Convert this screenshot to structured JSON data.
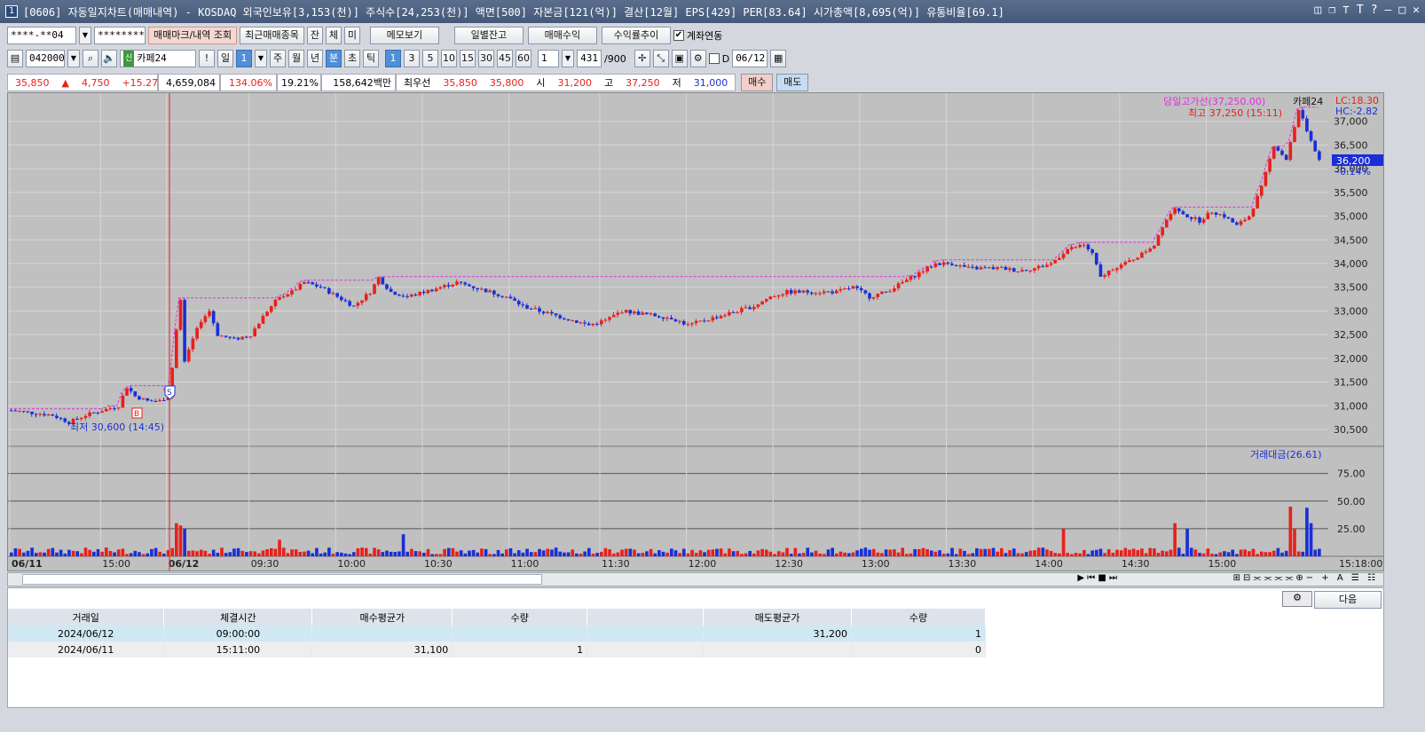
{
  "title": {
    "window_number": "1",
    "text": "[0606] 자동일지차트(매매내역) - KOSDAQ 외국인보유[3,153(천)] 주식수[24,253(천)] 액면[500] 자본금[121(억)] 결산[12월] EPS[429] PER[83.64] 시가총액[8,695(억)] 유통비율[69.1]"
  },
  "toolbar1": {
    "account": "****-**04",
    "password": "********",
    "mark_btn": "매매마크/내역 조회",
    "recent_btn": "최근매매종목",
    "jan": "잔",
    "che": "체",
    "mi": "미",
    "memo": "메모보기",
    "daily_balance": "일별잔고",
    "trade_profit": "매매수익",
    "profit_trend": "수익률추이",
    "account_link": "계좌연동"
  },
  "toolbar2": {
    "code": "042000",
    "badge": "신",
    "stock_name": "카페24",
    "excl": "!",
    "il": "일",
    "il_val": "1",
    "ju": "주",
    "wol": "월",
    "nyeon": "년",
    "bun": "분",
    "cho": "초",
    "tick": "틱",
    "intervals": [
      "1",
      "3",
      "5",
      "10",
      "15",
      "30",
      "45",
      "60"
    ],
    "period": "1",
    "count": "431",
    "count_total": "/900",
    "d_label": "D",
    "date": "06/12"
  },
  "infobar": {
    "price": "35,850",
    "arrow": "▲",
    "change": "4,750",
    "change_pct": "+15.27%",
    "volume": "4,659,084",
    "vol_ratio": "134.06%",
    "turnover": "19.21%",
    "amount": "158,642백만",
    "best_label": "최우선",
    "best_ask": "35,850",
    "best_bid": "35,800",
    "open_label": "시",
    "open": "31,200",
    "high_label": "고",
    "high": "37,250",
    "low_label": "저",
    "low": "31,000",
    "buy": "매수",
    "sell": "매도"
  },
  "chart_labels": {
    "day_high_line": "당일고가선(37,250.00)",
    "stock_tag": "카페24",
    "lc": "LC:18.30",
    "hc": "HC:-2.82",
    "max_label": "최고 37,250 (15:11)",
    "min_label": "최저 30,600 (14:45)",
    "current_price": "36,200",
    "current_pct": "-0.14%",
    "mark_b": "B",
    "mark_s": "S",
    "volume_label": "거래대금(26.61)",
    "last_time": "15:18:00"
  },
  "colors": {
    "up": "#e8201b",
    "down": "#1a2fd6",
    "high_line": "#e030e0",
    "background": "#c0c0c0"
  },
  "chart_data": {
    "type": "candlestick",
    "price_axis": [
      "37,000",
      "36,500",
      "36,000",
      "35,500",
      "35,000",
      "34,500",
      "34,000",
      "33,500",
      "33,000",
      "32,500",
      "32,000",
      "31,500",
      "31,000",
      "30,500"
    ],
    "volume_axis": [
      "75.00",
      "50.00",
      "25.00"
    ],
    "time_labels": [
      "06/11",
      "15:00",
      "06/12",
      "09:30",
      "10:00",
      "10:30",
      "11:00",
      "11:30",
      "12:00",
      "12:30",
      "13:00",
      "13:30",
      "14:00",
      "14:30",
      "15:00"
    ],
    "ylim": [
      30200,
      37500
    ],
    "close_path": [
      [
        0,
        30900
      ],
      [
        5,
        30850
      ],
      [
        10,
        30800
      ],
      [
        14,
        30650
      ],
      [
        18,
        30800
      ],
      [
        22,
        30900
      ],
      [
        26,
        31000
      ],
      [
        28,
        31400
      ],
      [
        30,
        31200
      ],
      [
        33,
        31100
      ],
      [
        36,
        31100
      ],
      [
        38,
        31200
      ],
      [
        39,
        31800
      ],
      [
        40,
        32600
      ],
      [
        41,
        33200
      ],
      [
        42,
        31900
      ],
      [
        44,
        32400
      ],
      [
        46,
        32800
      ],
      [
        48,
        33000
      ],
      [
        50,
        32500
      ],
      [
        54,
        32400
      ],
      [
        58,
        32500
      ],
      [
        62,
        33000
      ],
      [
        65,
        33300
      ],
      [
        68,
        33400
      ],
      [
        71,
        33600
      ],
      [
        75,
        33500
      ],
      [
        79,
        33300
      ],
      [
        83,
        33100
      ],
      [
        87,
        33400
      ],
      [
        89,
        33700
      ],
      [
        92,
        33400
      ],
      [
        96,
        33300
      ],
      [
        100,
        33400
      ],
      [
        104,
        33500
      ],
      [
        108,
        33600
      ],
      [
        112,
        33500
      ],
      [
        116,
        33400
      ],
      [
        120,
        33300
      ],
      [
        124,
        33100
      ],
      [
        128,
        33000
      ],
      [
        132,
        32900
      ],
      [
        136,
        32800
      ],
      [
        140,
        32700
      ],
      [
        144,
        32800
      ],
      [
        148,
        33000
      ],
      [
        152,
        32950
      ],
      [
        156,
        32900
      ],
      [
        160,
        32850
      ],
      [
        164,
        32700
      ],
      [
        168,
        32800
      ],
      [
        172,
        32900
      ],
      [
        176,
        33000
      ],
      [
        180,
        33100
      ],
      [
        184,
        33300
      ],
      [
        188,
        33400
      ],
      [
        192,
        33400
      ],
      [
        196,
        33400
      ],
      [
        200,
        33400
      ],
      [
        204,
        33500
      ],
      [
        208,
        33300
      ],
      [
        212,
        33400
      ],
      [
        216,
        33600
      ],
      [
        220,
        33800
      ],
      [
        224,
        34000
      ],
      [
        228,
        34000
      ],
      [
        232,
        33900
      ],
      [
        236,
        33900
      ],
      [
        240,
        33900
      ],
      [
        244,
        33850
      ],
      [
        248,
        33900
      ],
      [
        252,
        34000
      ],
      [
        256,
        34300
      ],
      [
        260,
        34400
      ],
      [
        262,
        34200
      ],
      [
        264,
        33700
      ],
      [
        267,
        33900
      ],
      [
        270,
        34000
      ],
      [
        274,
        34200
      ],
      [
        277,
        34400
      ],
      [
        279,
        34800
      ],
      [
        282,
        35200
      ],
      [
        285,
        35000
      ],
      [
        288,
        34900
      ],
      [
        291,
        35100
      ],
      [
        294,
        35000
      ],
      [
        297,
        34800
      ],
      [
        300,
        35000
      ],
      [
        303,
        35600
      ],
      [
        306,
        36500
      ],
      [
        309,
        36200
      ],
      [
        312,
        37250
      ],
      [
        315,
        36600
      ],
      [
        317,
        36200
      ]
    ],
    "volume_spikes": [
      [
        40,
        30
      ],
      [
        41,
        28
      ],
      [
        42,
        25
      ],
      [
        65,
        15
      ],
      [
        95,
        20
      ],
      [
        255,
        25
      ],
      [
        282,
        30
      ],
      [
        285,
        25
      ],
      [
        310,
        45
      ],
      [
        311,
        25
      ],
      [
        314,
        44
      ],
      [
        315,
        30
      ]
    ]
  },
  "grid_table": {
    "headers": [
      "거래일",
      "체결시간",
      "매수평균가",
      "수량",
      "",
      "매도평균가",
      "수량"
    ],
    "rows": [
      [
        "2024/06/12",
        "09:00:00",
        "",
        "",
        "",
        "31,200",
        "1"
      ],
      [
        "2024/06/11",
        "15:11:00",
        "31,100",
        "1",
        "",
        "",
        "0"
      ]
    ],
    "next_btn": "다음"
  }
}
